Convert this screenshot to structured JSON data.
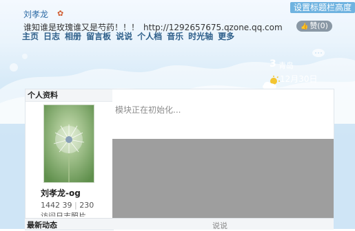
{
  "header": {
    "settings_label": "设置标题栏高度",
    "title": "刘孝龙",
    "description": "谁知谁是玫瑰谁又是芍药！！！",
    "url": "http://1292657675.qzone.qq.com",
    "like_label": "赞(0)"
  },
  "nav": {
    "items": [
      "主页",
      "日志",
      "相册",
      "留言板",
      "说说",
      "个人档",
      "音乐",
      "时光轴",
      "更多"
    ]
  },
  "weather": {
    "temp": "3",
    "city": "青岛",
    "date": "12月30日",
    "icon": "partly-cloudy-icon"
  },
  "profile": {
    "header": "个人资料",
    "nickname": "刘孝龙-og",
    "stats": [
      "1442",
      "39",
      "230"
    ],
    "stats_labels": "访问日志照片"
  },
  "main": {
    "loading_text": "模块正在初始化..."
  },
  "bottom": {
    "left_label": "最新动态",
    "mid_label": "说说"
  },
  "colors": {
    "accent": "#6fb3e0",
    "nav_text": "#2e5f8a",
    "title_text": "#2c6aa4",
    "overlay": "#9e9e9e"
  }
}
